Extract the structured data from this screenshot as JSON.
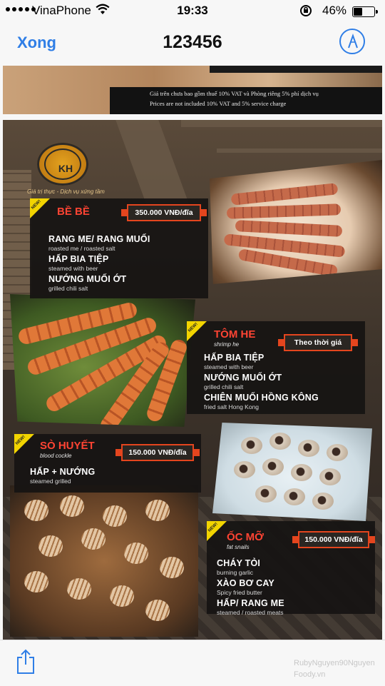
{
  "status_bar": {
    "carrier": "VinaPhone",
    "time": "19:33",
    "battery_percent_label": "46%",
    "battery_level": 0.46
  },
  "nav": {
    "done_label": "Xong",
    "title": "123456"
  },
  "document": {
    "price_note_vi": "Giá trên chưa bao gồm thuế 10% VAT và Phòng riêng 5% phí dịch vụ",
    "price_note_en": "Prices are not included 10% VAT and 5% service charge",
    "tagline": "Giá trị thực - Dịch vụ xứng tầm",
    "new_tag": "NEW!",
    "dishes": [
      {
        "name": "BỀ BỀ",
        "english": "",
        "price": "350.000 VNĐ/đĩa",
        "methods": [
          {
            "vi": "RANG ME/ RANG MUỐI",
            "en": "roasted me / roasted salt"
          },
          {
            "vi": "HẤP BIA TIỆP",
            "en": "steamed with beer"
          },
          {
            "vi": "NƯỚNG MUỐI ỚT",
            "en": "grilled chili salt"
          }
        ]
      },
      {
        "name": "TÔM HE",
        "english": "shrimp he",
        "price": "Theo thời giá",
        "methods": [
          {
            "vi": "HẤP BIA TIỆP",
            "en": "steamed with beer"
          },
          {
            "vi": "NƯỚNG MUỐI ỚT",
            "en": "grilled chili salt"
          },
          {
            "vi": "CHIÊN MUỐI HỒNG KÔNG",
            "en": "fried salt Hong Kong"
          }
        ]
      },
      {
        "name": "SÒ HUYẾT",
        "english": "blood cockle",
        "price": "150.000 VNĐ/đĩa",
        "methods": [
          {
            "vi": "HẤP + NƯỚNG",
            "en": "steamed grilled"
          }
        ]
      },
      {
        "name": "ỐC MỠ",
        "english": "fat snails",
        "price": "150.000 VNĐ/đĩa",
        "methods": [
          {
            "vi": "CHÁY TỎI",
            "en": "burning garlic"
          },
          {
            "vi": "XÀO BƠ CAY",
            "en": "Spicy fried butter"
          },
          {
            "vi": "HẤP/ RANG ME",
            "en": "steamed / roasted meats"
          }
        ]
      }
    ]
  },
  "toolbar": {
    "watermark_user": "RubyNguyen90Nguyen",
    "watermark_brand": "Foody.vn"
  },
  "colors": {
    "accent_blue": "#2f7ee6",
    "dish_red": "#ff4433",
    "price_border": "#e4451e",
    "new_tag_yellow": "#f2d400"
  }
}
